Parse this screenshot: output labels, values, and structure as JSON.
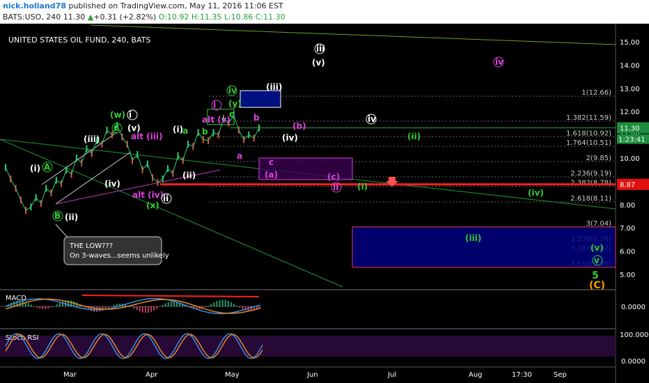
{
  "header": {
    "author": "nick.holland78",
    "published": "published on TradingView.com, May 11, 2016 11:06 EST",
    "symbol": "BATS:USO, 240",
    "last": "11.30",
    "change": "+0.31 (+2.82%)",
    "ohlc_o": "O:10.92",
    "ohlc_h": "H:11.35",
    "ohlc_l": "L:10.86",
    "ohlc_c": "C:11.30"
  },
  "chart_data": {
    "type": "line",
    "title": "UNITED STATES OIL FUND, 240, BATS",
    "x_ticks": [
      "Mar",
      "Apr",
      "May",
      "Jun",
      "Jul",
      "Aug",
      "17:30",
      "Sep"
    ],
    "y_ticks": [
      "15.00",
      "14.00",
      "13.00",
      "12.00",
      "11.00",
      "10.00",
      "9.00",
      "8.00",
      "7.00",
      "6.00",
      "5.00"
    ],
    "ylim": [
      4.5,
      15.5
    ],
    "price_labels": {
      "last": "11.30",
      "countdown": "1:23:41",
      "level": "8.87"
    },
    "fib_levels": [
      {
        "label": "1(12.66)",
        "value": 12.66
      },
      {
        "label": "1.382(11.59)",
        "value": 11.59
      },
      {
        "label": "1.618(10.92)",
        "value": 10.92
      },
      {
        "label": "1.764(10.51)",
        "value": 10.51
      },
      {
        "label": "2(9.85)",
        "value": 9.85
      },
      {
        "label": "2.236(9.19)",
        "value": 9.19
      },
      {
        "label": "2.382(8.78)",
        "value": 8.78
      },
      {
        "label": "2.618(8.11)",
        "value": 8.11
      },
      {
        "label": "3(7.04)",
        "value": 7.04
      },
      {
        "label": "3.236(6.38)",
        "value": 6.38
      },
      {
        "label": "3.382(5.97)",
        "value": 5.97
      },
      {
        "label": "3.618(5.30)",
        "value": 5.3
      }
    ],
    "price_path": [
      9.6,
      9.1,
      8.7,
      8.2,
      7.75,
      7.9,
      8.3,
      8.05,
      8.7,
      8.5,
      9.05,
      8.9,
      9.5,
      9.3,
      10.0,
      9.8,
      10.4,
      10.2,
      10.75,
      10.6,
      11.2,
      11.0,
      11.4,
      10.9,
      10.6,
      9.9,
      10.15,
      9.5,
      9.75,
      9.15,
      8.95,
      9.1,
      9.55,
      9.35,
      10.1,
      9.9,
      10.6,
      10.5,
      11.1,
      10.8,
      10.75,
      11.1,
      11.0,
      11.7,
      11.5,
      11.85,
      11.2,
      10.8,
      11.0,
      10.86,
      11.3
    ],
    "waves": [
      {
        "text": "(i)",
        "color": "#ffffff"
      },
      {
        "text": "A",
        "color": "#33cc33"
      },
      {
        "text": "B",
        "color": "#33cc33"
      },
      {
        "text": "(ii)",
        "color": "#ffffff"
      },
      {
        "text": "(iii)",
        "color": "#ffffff"
      },
      {
        "text": "(iv)",
        "color": "#ffffff"
      },
      {
        "text": "(w)",
        "color": "#33cc33"
      },
      {
        "text": "i",
        "color": "#ffffff"
      },
      {
        "text": "C",
        "color": "#33cc33"
      },
      {
        "text": "(v)",
        "color": "#ffffff"
      },
      {
        "text": "alt (iii)",
        "color": "#e040e0"
      },
      {
        "text": "alt (iv)",
        "color": "#e040e0"
      },
      {
        "text": "(x)",
        "color": "#33cc33"
      },
      {
        "text": "ii",
        "color": "#ffffff"
      },
      {
        "text": "(i)",
        "color": "#ffffff"
      },
      {
        "text": "a",
        "color": "#33cc33"
      },
      {
        "text": "(ii)",
        "color": "#ffffff"
      },
      {
        "text": "b",
        "color": "#33cc33"
      },
      {
        "text": "alt (v)",
        "color": "#e040e0"
      },
      {
        "text": "i",
        "color": "#e040e0"
      },
      {
        "text": "iv",
        "color": "#33cc33"
      },
      {
        "text": "(y)",
        "color": "#33cc33"
      },
      {
        "text": "c",
        "color": "#33cc33"
      },
      {
        "text": "(iii)",
        "color": "#ffffff"
      },
      {
        "text": "b",
        "color": "#e040e0"
      },
      {
        "text": "a",
        "color": "#e040e0"
      },
      {
        "text": "c",
        "color": "#e040e0"
      },
      {
        "text": "(a)",
        "color": "#e040e0"
      },
      {
        "text": "(b)",
        "color": "#e040e0"
      },
      {
        "text": "(c)",
        "color": "#e040e0"
      },
      {
        "text": "ii",
        "color": "#e040e0"
      },
      {
        "text": "(iv)",
        "color": "#ffffff"
      },
      {
        "text": "iii",
        "color": "#ffffff"
      },
      {
        "text": "(v)",
        "color": "#ffffff"
      },
      {
        "text": "iv",
        "color": "#ffffff"
      },
      {
        "text": "(i)",
        "color": "#33cc33"
      },
      {
        "text": "(ii)",
        "color": "#33cc33"
      },
      {
        "text": "iv",
        "color": "#e040e0"
      },
      {
        "text": "(iii)",
        "color": "#33cc33"
      },
      {
        "text": "(iv)",
        "color": "#33cc33"
      },
      {
        "text": "(v)",
        "color": "#33cc33"
      },
      {
        "text": "v",
        "color": "#33cc33"
      },
      {
        "text": "5",
        "color": "#33cc33"
      },
      {
        "text": "(C)",
        "color": "#ff9900"
      }
    ],
    "callout": {
      "title": "THE LOW???",
      "body": "On 3-waves...seems unlikely"
    },
    "macd": {
      "name": "MACD",
      "y_ticks": [
        "0.0000"
      ]
    },
    "stoch": {
      "name": "Stoch RSI",
      "y_ticks": [
        "100.0000",
        "0.0000"
      ]
    },
    "colors": {
      "green": "#33cc33",
      "magenta": "#e040e0",
      "red": "#ff2020",
      "orange": "#ff9900",
      "navy": "#000080"
    }
  }
}
